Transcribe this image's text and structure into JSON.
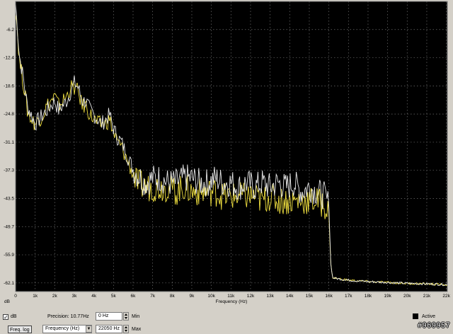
{
  "plot": {
    "ylabel": "dB",
    "xlabel": "Frequency (Hz)",
    "y_ticks": [
      "-6.2",
      "-12.4",
      "-18.6",
      "-24.8",
      "-31.1",
      "-37.3",
      "-43.5",
      "-49.7",
      "-55.9",
      "-62.1"
    ],
    "x_ticks": [
      "0",
      "1k",
      "2k",
      "3k",
      "4k",
      "5k",
      "6k",
      "7k",
      "8k",
      "9k",
      "10k",
      "11k",
      "12k",
      "13k",
      "14k",
      "15k",
      "16k",
      "17k",
      "18k",
      "19k",
      "20k",
      "21k",
      "22k"
    ],
    "colors": {
      "background": "#000000",
      "grid": "#6e6e6e",
      "series_a": "#f0e040",
      "series_b": "#e8e8e8"
    }
  },
  "chart_data": {
    "type": "line",
    "xlabel": "Frequency (Hz)",
    "ylabel": "dB",
    "xlim": [
      0,
      22050
    ],
    "ylim": [
      -64,
      0
    ],
    "grid": true,
    "series": [
      {
        "x": [
          0,
          200,
          400,
          600,
          800,
          1000,
          1200,
          1400,
          1600,
          1800,
          2000,
          2200,
          2400,
          2600,
          2800,
          3000,
          3200,
          3400,
          3600,
          3800,
          4000,
          4200,
          4400,
          4600,
          4800,
          5000,
          5200,
          5400,
          5600,
          5800,
          6000,
          6200,
          6600,
          7000,
          7400,
          7800,
          8200,
          8600,
          9000,
          9400,
          9800,
          10200,
          10600,
          11000,
          11400,
          11800,
          12200,
          12600,
          13000,
          13400,
          13800,
          14200,
          14600,
          15000,
          15400,
          15800,
          16000,
          16100,
          16200,
          17000,
          18000,
          19000,
          20000,
          21000,
          22050
        ],
        "y": [
          -0.5,
          -12,
          -17,
          -23,
          -25,
          -27,
          -26,
          -25,
          -24,
          -23,
          -22,
          -24,
          -23,
          -22,
          -20,
          -18,
          -19,
          -22,
          -22,
          -24,
          -25,
          -26,
          -27,
          -26,
          -25,
          -28,
          -30,
          -31,
          -33,
          -35,
          -37,
          -38,
          -40,
          -39,
          -39,
          -40,
          -40,
          -39,
          -39,
          -40,
          -40,
          -39,
          -40,
          -40,
          -41,
          -40,
          -41,
          -40,
          -41,
          -40,
          -41,
          -40,
          -42,
          -41,
          -42,
          -43,
          -45,
          -58,
          -61,
          -61.5,
          -61.8,
          -62,
          -62.2,
          -62.3,
          -62.5
        ]
      },
      {
        "x": [
          0,
          200,
          400,
          600,
          800,
          1000,
          1200,
          1400,
          1600,
          1800,
          2000,
          2200,
          2400,
          2600,
          2800,
          3000,
          3200,
          3400,
          3600,
          3800,
          4000,
          4200,
          4400,
          4600,
          4800,
          5000,
          5200,
          5400,
          5600,
          5800,
          6000,
          6200,
          6600,
          7000,
          7400,
          7800,
          8200,
          8600,
          9000,
          9400,
          9800,
          10200,
          10600,
          11000,
          11400,
          11800,
          12200,
          12600,
          13000,
          13400,
          13800,
          14200,
          14600,
          15000,
          15400,
          15800,
          16000,
          16100,
          16200,
          17000,
          18000,
          19000,
          20000,
          21000,
          22050
        ],
        "y": [
          -1,
          -13,
          -18,
          -24,
          -26,
          -27,
          -26,
          -25,
          -23,
          -22,
          -21,
          -23,
          -22,
          -21,
          -19,
          -19,
          -20,
          -23,
          -23,
          -25,
          -26,
          -27,
          -27,
          -27,
          -26,
          -29,
          -31,
          -32,
          -34,
          -36,
          -38,
          -40,
          -41,
          -41,
          -41,
          -41,
          -42,
          -41,
          -42,
          -42,
          -42,
          -42,
          -43,
          -43,
          -43,
          -43,
          -43,
          -44,
          -43,
          -44,
          -44,
          -44,
          -44,
          -44,
          -44,
          -45,
          -47,
          -58,
          -61,
          -61.5,
          -61.8,
          -62,
          -62.2,
          -62.3,
          -62.5
        ]
      }
    ]
  },
  "controls": {
    "db_checkbox_label": "dB",
    "precision_label": "Precision: 10.77Hz",
    "min_value": "0 Hz",
    "min_label": "Min",
    "max_value": "22050 Hz",
    "max_label": "Max",
    "freq_log_button": "Freq. log",
    "axis_select_value": "Frequency (Hz)",
    "active_label": "Active"
  },
  "watermark": "#969957"
}
